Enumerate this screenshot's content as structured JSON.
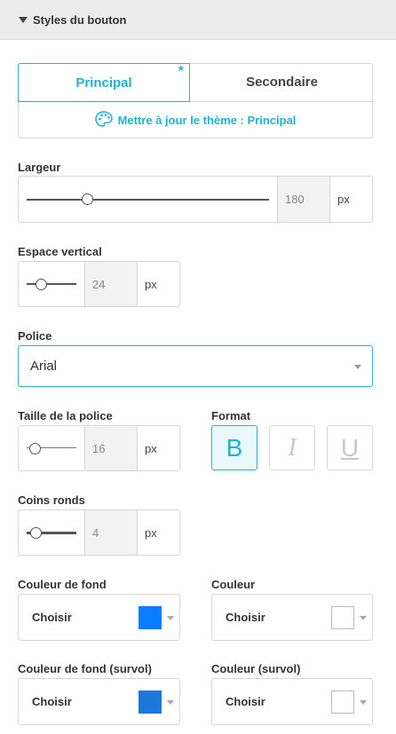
{
  "panel": {
    "title": "Styles du bouton"
  },
  "tabs": {
    "primary_label": "Principal",
    "secondary_label": "Secondaire",
    "modified_marker": "*",
    "theme_update_label": "Mettre à jour le thème : Principal"
  },
  "width": {
    "label": "Largeur",
    "value": "180",
    "unit": "px"
  },
  "vertical_spacing": {
    "label": "Espace vertical",
    "value": "24",
    "unit": "px"
  },
  "font": {
    "label": "Police",
    "value": "Arial"
  },
  "font_size": {
    "label": "Taille de la police",
    "value": "16",
    "unit": "px"
  },
  "format": {
    "label": "Format",
    "bold": "B",
    "italic": "I",
    "underline": "U",
    "bold_active": true
  },
  "corners": {
    "label": "Coins ronds",
    "value": "4",
    "unit": "px"
  },
  "colors": {
    "background": {
      "label": "Couleur de fond",
      "button": "Choisir",
      "swatch": "#0a7cff"
    },
    "text": {
      "label": "Couleur",
      "button": "Choisir",
      "swatch": "#ffffff"
    },
    "background_hover": {
      "label": "Couleur de fond (survol)",
      "button": "Choisir",
      "swatch": "#1a78db"
    },
    "text_hover": {
      "label": "Couleur (survol)",
      "button": "Choisir",
      "swatch": "#ffffff"
    }
  },
  "accent_color": "#21b2cf"
}
